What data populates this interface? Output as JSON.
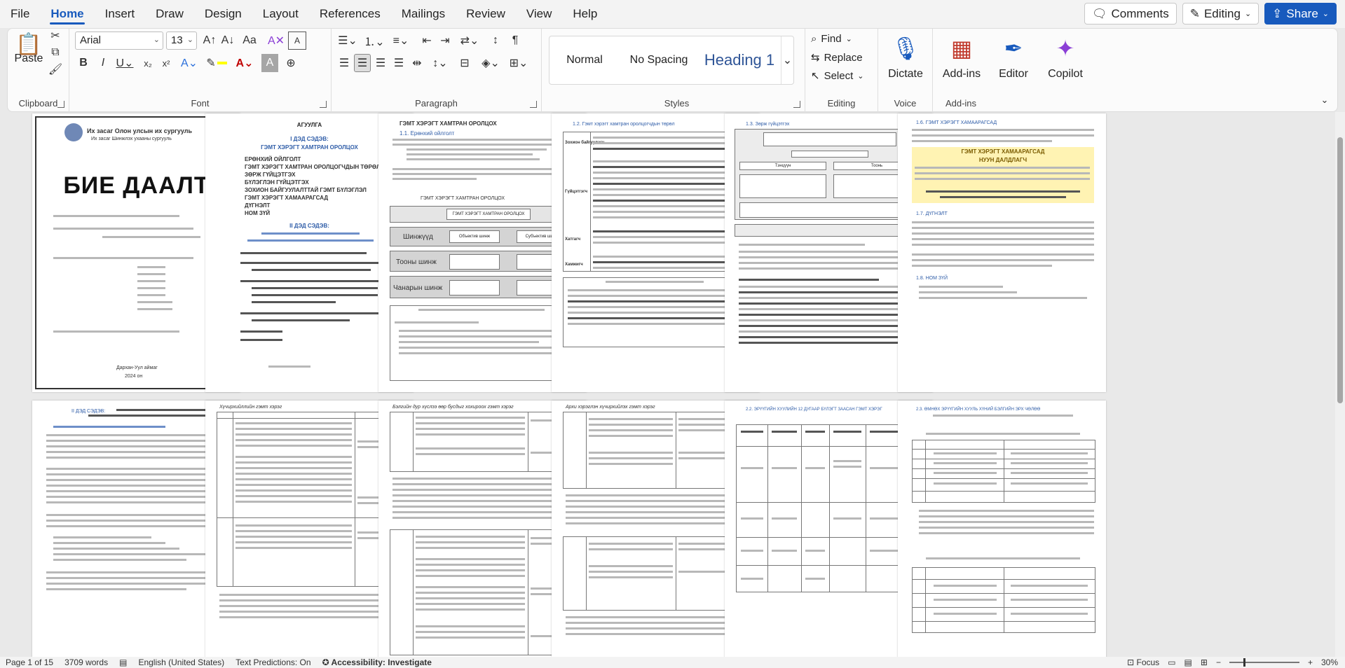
{
  "menu": {
    "tabs": [
      "File",
      "Home",
      "Insert",
      "Draw",
      "Design",
      "Layout",
      "References",
      "Mailings",
      "Review",
      "View",
      "Help"
    ],
    "active": "Home",
    "comments_label": "Comments",
    "editing_label": "Editing",
    "share_label": "Share"
  },
  "ribbon": {
    "clipboard": {
      "label": "Clipboard",
      "paste_label": "Paste"
    },
    "font": {
      "label": "Font",
      "font_name": "Arial",
      "font_size": "13"
    },
    "paragraph": {
      "label": "Paragraph"
    },
    "styles": {
      "label": "Styles",
      "items": [
        "Normal",
        "No Spacing",
        "Heading 1"
      ]
    },
    "editing": {
      "label": "Editing",
      "find_label": "Find",
      "replace_label": "Replace",
      "select_label": "Select"
    },
    "voice": {
      "label": "Voice",
      "dictate_label": "Dictate"
    },
    "addins": {
      "label": "Add-ins",
      "addins_label": "Add-ins",
      "editor_label": "Editor",
      "copilot_label": "Copilot"
    }
  },
  "pages": {
    "p1_title": "БИЕ ДААЛТ",
    "p1_header": "Их засаг Олон улсын их сургууль",
    "p1_subheader": "Их засаг Шинжлэх ухааны сургууль",
    "p1_footer": "Дархан-Уул аймаг",
    "p1_year": "2024 он",
    "p2_title": "АГУУЛГА",
    "p2_part1": "I ДЭД СЭДЭВ:",
    "p2_part1_title": "ГЭМТ ХЭРЭГТ ХАМТРАН ОРОЛЦОХ",
    "p2_toc": [
      "ЕРӨНХИЙ ОЙЛГОЛТ",
      "ГЭМТ ХЭРЭГТ ХАМТРАН ОРОЛЦОГЧДЫН ТӨРӨЛ",
      "ЗӨРЖ ГҮЙЦЭТГЭХ",
      "БҮЛЭГЛЭН ГҮЙЦЭТГЭХ",
      "ЗОХИОН БАЙГУУЛАЛТТАЙ ГЭМТ БҮЛЭГЛЭЛ",
      "ГЭМТ ХЭРЭГТ ХАМААРАГСАД",
      "ДҮГНЭЛТ",
      "НОМ ЗҮЙ"
    ],
    "p2_part2": "II ДЭД СЭДЭВ:",
    "p3_title": "ГЭМТ ХЭРЭГТ ХАМТРАН ОРОЛЦОХ",
    "p3_section": "1.1. Ерөнхий ойлголт",
    "p3_diagram_title": "ГЭМТ ХЭРЭГТ ХАМТРАН ОРОЛЦОХ",
    "p3_diagram_labels": [
      "Шинжүүд",
      "Тооны шинж",
      "Чанарын шинж"
    ],
    "p3_diagram_boxes": [
      "Объектив шинж",
      "Субъектив шинж"
    ],
    "p4_title": "1.2. Гэмт хэрэгт хамтран оролцогчдын төрөл",
    "p4_rows": [
      "Зохион байгуулагч",
      "Гүйцэтгэгч",
      "Хатгагч",
      "Хамжигч"
    ],
    "p5_title": "1.3. Зөрж гүйцэтгэх",
    "p5_boxes": [
      "Тэнцүүн",
      "Тоонь"
    ],
    "p6_section": "1.6. ГЭМТ ХЭРЭГТ ХАМААРАГСАД",
    "p6_highlight": "ГЭМТ ХЭРЭГТ ХАМААРАГСАД",
    "p6_highlight2": "НУУН ДАЛДЛАГЧ",
    "p6_conclusion": "1.7. ДҮГНЭЛТ",
    "p6_biblio": "1.8. НОМ ЗҮЙ",
    "row2_p1_title": "II ДЭД СЭДЭВ:",
    "row2_p2_title": "Хүчирхийллийн гэмт хэрэг",
    "row2_p3_title": "Бэлгийн дур хүслээ өөр бусдыг хохироох гэмт хэрэг",
    "row2_p4_title": "Архи хэрэглэн хүчирхийлэх гэмт хэрэг",
    "row2_p5_title": "2.2. ЭРҮҮГИЙН ХУУЛИЙН 12 ДУГААР БҮЛЭГТ ЗААСАН ГЭМТ ХЭРЭГ",
    "row2_p6_title": "2.3. ӨМНӨХ ЭРҮҮГИЙН ХУУЛЬ ХҮНИЙ БЭЛГИЙН ЭРХ ЧӨЛӨӨ"
  },
  "status": {
    "page": "Page 1 of 15",
    "words": "3709 words",
    "language": "English (United States)",
    "predictions": "Text Predictions: On",
    "accessibility": "Accessibility: Investigate",
    "focus": "Focus",
    "zoom": "30%"
  },
  "colors": {
    "accent": "#185abd",
    "heading": "#2f5597"
  }
}
